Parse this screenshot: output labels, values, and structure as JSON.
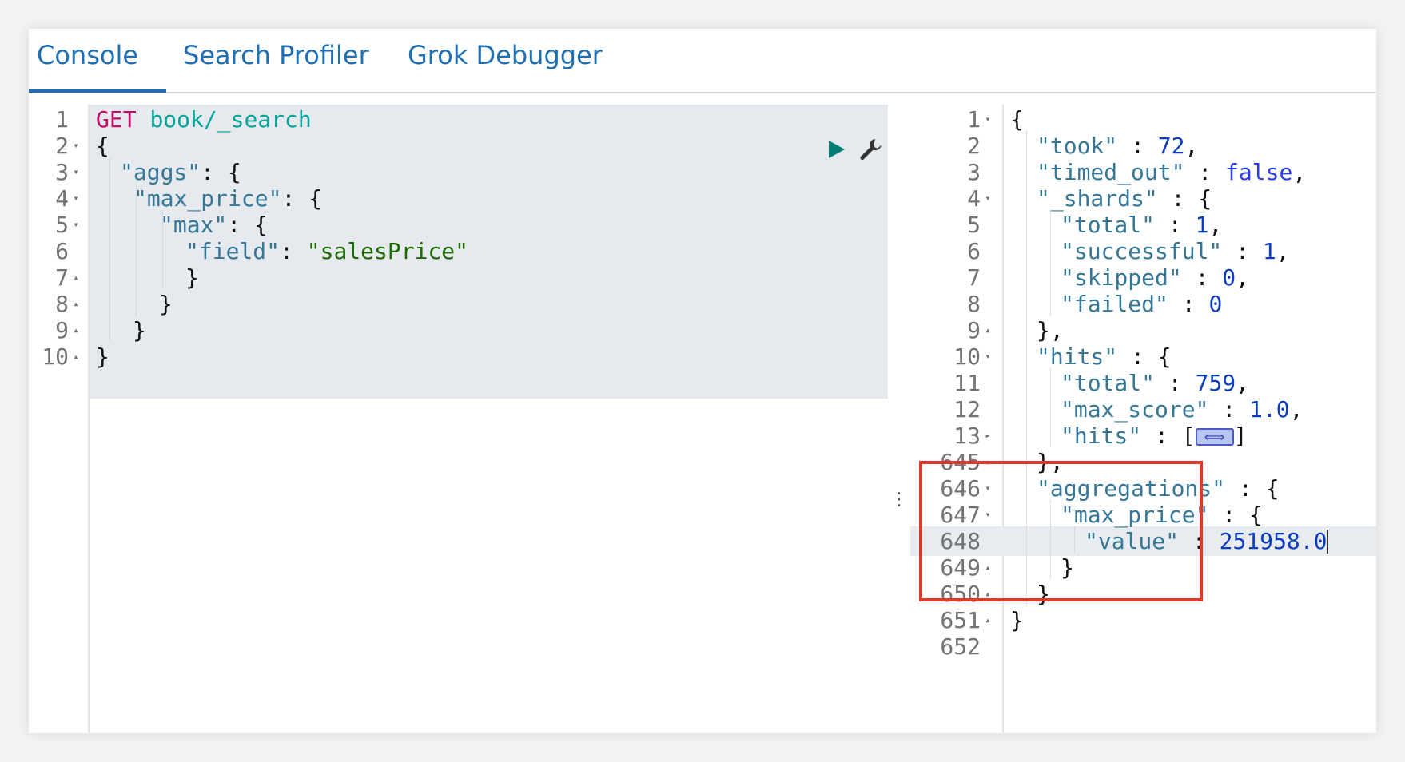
{
  "tabs": [
    {
      "label": "Console",
      "active": true
    },
    {
      "label": "Search Profiler",
      "active": false
    },
    {
      "label": "Grok Debugger",
      "active": false
    }
  ],
  "request": {
    "method": "GET",
    "url": "book/_search",
    "line_numbers": [
      "1",
      "2",
      "3",
      "4",
      "5",
      "6",
      "7",
      "8",
      "9",
      "10"
    ],
    "code": {
      "l2": "{",
      "l3_key": "\"aggs\"",
      "l3_rest": ": {",
      "l4_key": "\"max_price\"",
      "l4_rest": ": {",
      "l5_key": "\"max\"",
      "l5_rest": ": {",
      "l6_key": "\"field\"",
      "l6_colon": ": ",
      "l6_val": "\"salesPrice\"",
      "l7": "}",
      "l8": "}",
      "l9": "}",
      "l10": "}"
    },
    "icons": [
      "play-icon",
      "wrench-icon"
    ]
  },
  "response": {
    "line_numbers": [
      "1",
      "2",
      "3",
      "4",
      "5",
      "6",
      "7",
      "8",
      "9",
      "10",
      "11",
      "12",
      "13",
      "645",
      "646",
      "647",
      "648",
      "649",
      "650",
      "651",
      "652"
    ],
    "code": {
      "r1": "{",
      "took_key": "\"took\"",
      "took_val": "72",
      "timed_out_key": "\"timed_out\"",
      "timed_out_val": "false",
      "shards_key": "\"_shards\"",
      "total_key": "\"total\"",
      "total_val": "1",
      "successful_key": "\"successful\"",
      "successful_val": "1",
      "skipped_key": "\"skipped\"",
      "skipped_val": "0",
      "failed_key": "\"failed\"",
      "failed_val": "0",
      "shards_close": "},",
      "hits_key": "\"hits\"",
      "hits_total_key": "\"total\"",
      "hits_total_val": "759",
      "max_score_key": "\"max_score\"",
      "max_score_val": "1.0",
      "hits_hits_key": "\"hits\"",
      "hits_close": "},",
      "aggregations_key": "\"aggregations\"",
      "max_price_key": "\"max_price\"",
      "value_key": "\"value\"",
      "value_val": "251958.0",
      "close_inner": "}",
      "close_agg": "}",
      "close_root": "}"
    }
  },
  "colors": {
    "tab_text": "#1f6fb2",
    "highlight_box": "#e2372b",
    "method": "#c80a68",
    "url": "#00a69b",
    "key": "#347797",
    "string": "#1b6b00",
    "number": "#0b3dc0"
  }
}
